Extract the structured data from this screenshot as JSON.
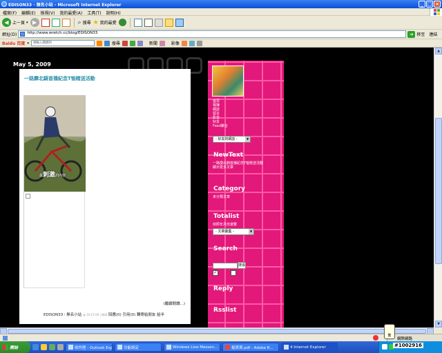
{
  "window": {
    "title": "EDISON33 - 無名小站 - Microsoft Internet Explorer"
  },
  "menu": [
    "檔案(F)",
    "編輯(E)",
    "檢視(V)",
    "我的最愛(A)",
    "工具(T)",
    "說明(H)"
  ],
  "toolbar": {
    "back_label": "上一頁",
    "search_label": "搜尋",
    "favorites_label": "我的最愛"
  },
  "address": {
    "label": "網址(D)",
    "url": "http://www.wretch.cc/blog/EDISON33",
    "go_label": "移至",
    "links_label": "連結"
  },
  "baidu": {
    "logo": "Baidu 百度",
    "placeholder": "請輸入關鍵詞",
    "search_label": "搜尋",
    "news_label": "新聞",
    "images_label": "影像"
  },
  "blog": {
    "date": "May 5, 2009",
    "post_title": "一路霹北騎首播紀念T恤贈送活動",
    "photo_caption_prefix": "最",
    "photo_caption_big": "刺激",
    "photo_caption_suffix": "的內容",
    "read_more": "(繼續閱讀...)",
    "footer_author": "EDISON33 ∶ 無名小站",
    "footer_time": "@ 10:27:00 | 修改",
    "footer_links": "回應(0) 引用(0) 轉寄給朋友 給半"
  },
  "sidebar": {
    "profile_lines": [
      "首頁",
      "相簿",
      "網誌",
      "留言",
      "影音",
      "好友",
      "Feed聚合"
    ],
    "friends_select": "- 好友的網誌 -",
    "newtext_heading": "NewText",
    "newtext_items": "一路霹北騎首播紀念T恤贈送活動",
    "newtext_more": "顯示更多文章",
    "category_heading": "Category",
    "category_items": "未分類文章",
    "totalist_heading": "Totalist",
    "totalist_text": "依照年月份瀏覽",
    "archive_select": "- 文章彙集 -",
    "search_heading": "Search",
    "search_button": "搜尋",
    "reply_heading": "Reply",
    "rsslist_heading": "Rsslist"
  },
  "taskbar": {
    "start_label": "開始",
    "items": [
      "收件匣 - Outlook Exp...",
      "功能設定",
      "Windows Live Messen...",
      "投資資.pdf - Adobe R...",
      "4 Internet Explorer"
    ],
    "tray_badge": "#1002916",
    "tray_text": "網際網路",
    "tray_tooltip": "繁"
  }
}
